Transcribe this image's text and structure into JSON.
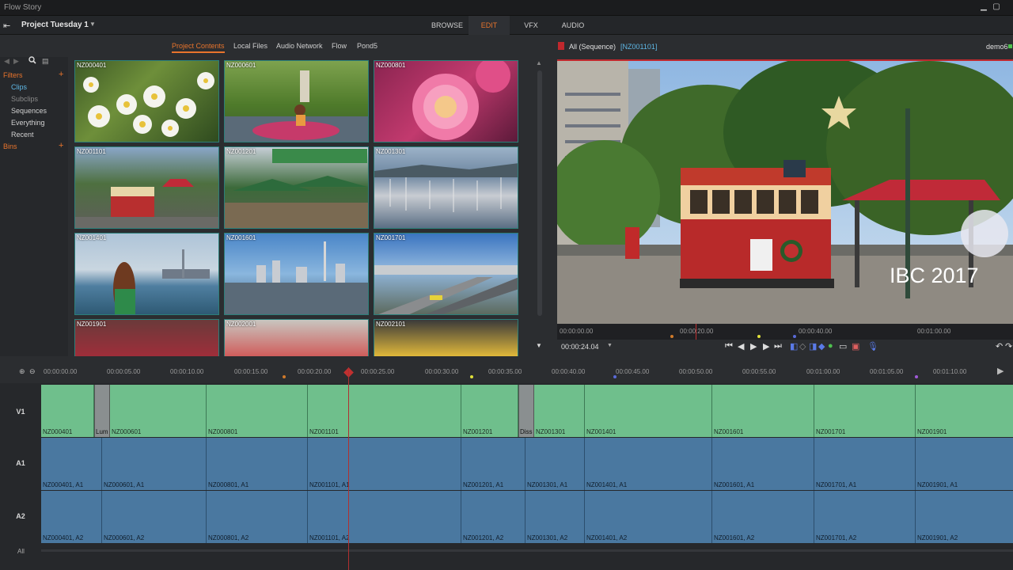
{
  "window": {
    "title": "Flow Story"
  },
  "project": {
    "name": "Project Tuesday 1",
    "arrow": "▼"
  },
  "main_tabs": [
    {
      "label": "BROWSE",
      "active": false
    },
    {
      "label": "EDIT",
      "active": true
    },
    {
      "label": "VFX",
      "active": false
    },
    {
      "label": "AUDIO",
      "active": false
    }
  ],
  "browser": {
    "tabs": [
      {
        "label": "Project Contents",
        "active": true
      },
      {
        "label": "Local Files",
        "active": false
      },
      {
        "label": "Audio Network",
        "active": false
      },
      {
        "label": "Flow",
        "active": false
      },
      {
        "label": "Pond5",
        "active": false
      }
    ],
    "filters_label": "Filters",
    "filters": [
      {
        "label": "Clips",
        "state": "selected"
      },
      {
        "label": "Subclips",
        "state": "dim"
      },
      {
        "label": "Sequences",
        "state": "normal"
      },
      {
        "label": "Everything",
        "state": "normal"
      },
      {
        "label": "Recent",
        "state": "normal"
      }
    ],
    "bins_label": "Bins",
    "clips": [
      "NZ000401",
      "NZ000601",
      "NZ000801",
      "NZ001101",
      "NZ001201",
      "NZ001301",
      "NZ001401",
      "NZ001601",
      "NZ001701",
      "NZ001901",
      "NZ002001",
      "NZ002101"
    ]
  },
  "viewer": {
    "title": "All (Sequence)",
    "clip_id": "[NZ001101]",
    "user": "demo6",
    "overlay_text": "IBC 2017",
    "ruler": [
      "00:00:00.00",
      "00:00:20.00",
      "00:00:40.00",
      "00:01:00.00"
    ],
    "timecode": "00:00:24.04"
  },
  "timeline": {
    "ruler": [
      "00:00:00.00",
      "00:00:05.00",
      "00:00:10.00",
      "00:00:15.00",
      "00:00:20.00",
      "00:00:25.00",
      "00:00:30.00",
      "00:00:35.00",
      "00:00:40.00",
      "00:00:45.00",
      "00:00:50.00",
      "00:00:55.00",
      "00:01:00.00",
      "00:01:05.00",
      "00:01:10.00"
    ],
    "tracks": {
      "v1": "V1",
      "a1": "A1",
      "a2": "A2"
    },
    "v1_clips": [
      "NZ000401",
      "Lum",
      "NZ000601",
      "NZ000801",
      "NZ001101",
      "NZ001201",
      "Diss",
      "NZ001301",
      "NZ001401",
      "NZ001601",
      "NZ001701",
      "NZ001901"
    ],
    "a1_clips": [
      "NZ000401, A1",
      "NZ000601, A1",
      "NZ000801, A1",
      "NZ001101, A1",
      "NZ001201, A1",
      "NZ001301, A1",
      "NZ001401, A1",
      "NZ001601, A1",
      "NZ001701, A1",
      "NZ001901, A1"
    ],
    "a2_clips": [
      "NZ000401, A2",
      "NZ000601, A2",
      "NZ000801, A2",
      "NZ001101, A2",
      "NZ001201, A2",
      "NZ001301, A2",
      "NZ001401, A2",
      "NZ001601, A2",
      "NZ001701, A2",
      "NZ001901, A2"
    ],
    "all_label": "All"
  },
  "colors": {
    "accent": "#e8742c",
    "selected": "#5fb8e6",
    "video_clip": "#6fbf8c",
    "audio_clip": "#4a78a0",
    "playhead": "#b03030"
  }
}
